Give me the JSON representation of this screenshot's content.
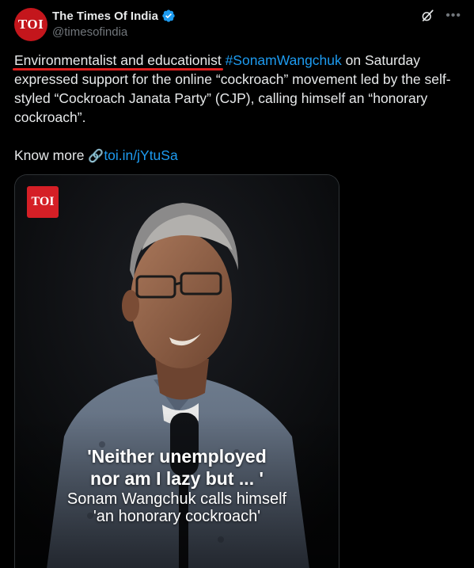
{
  "account": {
    "name": "The Times Of India",
    "handle": "@timesofindia",
    "avatar_text": "TOI",
    "verified": true
  },
  "icons": {
    "avatar": "toi-logo",
    "verified": "verified-badge-icon",
    "grok": "grok-icon",
    "more": "more-icon",
    "link": "link-emoji-icon"
  },
  "tweet": {
    "highlighted": "Environmentalist and educationist",
    "hashtag": "#SonamWangchuk",
    "text_after_hashtag": " on Saturday expressed support for the online “cockroach” movement led by the self-styled “Cockroach Janata Party” (CJP), calling himself an “honorary cockroach”.",
    "know_more": "Know more",
    "link_emoji": "🔗",
    "link": "toi.in/jYtuSa"
  },
  "media": {
    "badge_text": "TOI",
    "caption_line1": "'Neither unemployed",
    "caption_line2": "nor am I lazy but ... '",
    "caption_line3": "Sonam Wangchuk calls himself",
    "caption_line4": "'an honorary cockroach'"
  },
  "colors": {
    "background": "#000000",
    "text": "#e7e9ea",
    "muted": "#71767b",
    "link": "#1d9bf0",
    "brand_red": "#d51f26",
    "underline_red": "#e0201f"
  }
}
